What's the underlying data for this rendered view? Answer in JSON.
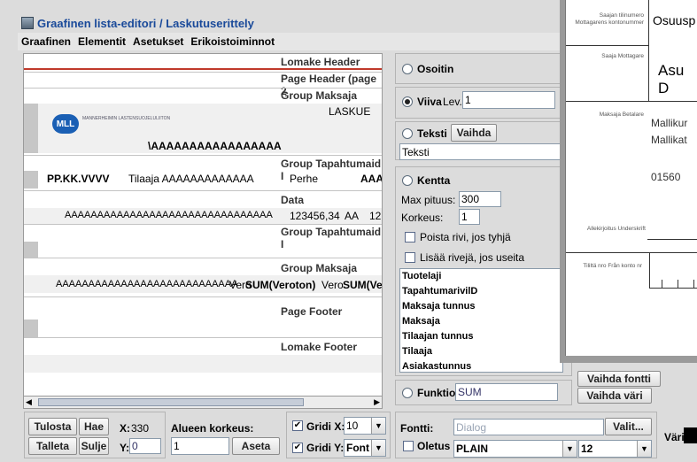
{
  "window": {
    "title": "Graafinen lista-editori / Laskutuserittely"
  },
  "menu": [
    "Graafinen",
    "Elementit",
    "Asetukset",
    "Erikoistoiminnot"
  ],
  "canvas": {
    "bands": {
      "lomake_header": "Lomake Header",
      "page_header": "Page Header (page 2",
      "group_maksaja_1": "Group Maksaja tunnu",
      "group_tapahtuma_1": "Group Tapahtumaid I",
      "data": "Data",
      "group_tapahtuma_2": "Group Tapahtumaid I",
      "group_maksaja_2": "Group Maksaja tunnu",
      "page_footer": "Page Footer",
      "lomake_footer": "Lomake Footer"
    },
    "laskue": "LASKUE",
    "logo_text": "MLL",
    "logo_sub": "MANNERHEIMIN LASTENSUOJELULIITON",
    "a_line": "\\AAAAAAAAAAAAAAAAA",
    "date_row": {
      "date": "PP.KK.VVVV",
      "tilaaja": "Tilaaja AAAAAAAAAAAAA",
      "perhe": "Perhe",
      "aaa": "AAA"
    },
    "data_row": {
      "a": "AAAAAAAAAAAAAAAAAAAAAAAAAAAAAAAA",
      "amount": "123456,34",
      "aa": "AA",
      "n": "12"
    },
    "sum_row": {
      "a": "AAAAAAAAAAAAAAAAAAAAAAAAAAAA",
      "vero1": "Vero",
      "sum1": "SUM(Veroton)",
      "vero2": "Vero",
      "sum2": "SUM(Ve"
    }
  },
  "side": {
    "osoitin": "Osoitin",
    "viiva": "Viiva",
    "lev": "Lev.",
    "lev_value": "1",
    "teksti": "Teksti",
    "vaihda": "Vaihda",
    "teksti_value": "Teksti",
    "kentta": "Kentta",
    "max_pituus": "Max pituus:",
    "max_pituus_value": "300",
    "korkeus": "Korkeus:",
    "korkeus_value": "1",
    "poista": "Poista rivi, jos tyhjä",
    "lisaa": "Lisää rivejä, jos useita",
    "fields": [
      "Tuotelaji",
      "TapahtumarivilD",
      "Maksaja tunnus",
      "Maksaja",
      "Tilaajan tunnus",
      "Tilaaja",
      "Asiakastunnus"
    ],
    "funktio": "Funktio",
    "funktio_value": "SUM",
    "vaihda_fontti": "Vaihda fontti",
    "vaihda_vari": "Vaihda väri"
  },
  "bottom": {
    "tulosta": "Tulosta",
    "hae": "Hae",
    "talleta": "Talleta",
    "sulje": "Sulje",
    "x_label": "X:",
    "x_value": "330",
    "y_label": "Y:",
    "y_value": "0",
    "alueen_korkeus": "Alueen korkeus:",
    "alueen_value": "1",
    "aseta": "Aseta",
    "gridi_x": "Gridi X:",
    "gridi_x_value": "10",
    "gridi_y": "Gridi Y:",
    "gridi_y_value": "Font",
    "fontti": "Fontti:",
    "fontti_value": "Dialog",
    "valit": "Valit...",
    "oletus": "Oletus",
    "style_value": "PLAIN",
    "size_value": "12",
    "vari": "Väri:"
  },
  "preview": {
    "saajan_tilinumero": "Saajan tilinumero Mottagarens kontonummer",
    "osuusp": "Osuusp",
    "saaja": "Saaja Mottagare",
    "asu": "Asu D",
    "maksaja": "Maksaja Betalare",
    "mallikur": "Mallikur",
    "mallikat": "Mallikat",
    "postal": "01560",
    "allekirjoitus": "Allekirjoitus Underskrift",
    "tililta": "Tililtä nro Från konto nr"
  }
}
